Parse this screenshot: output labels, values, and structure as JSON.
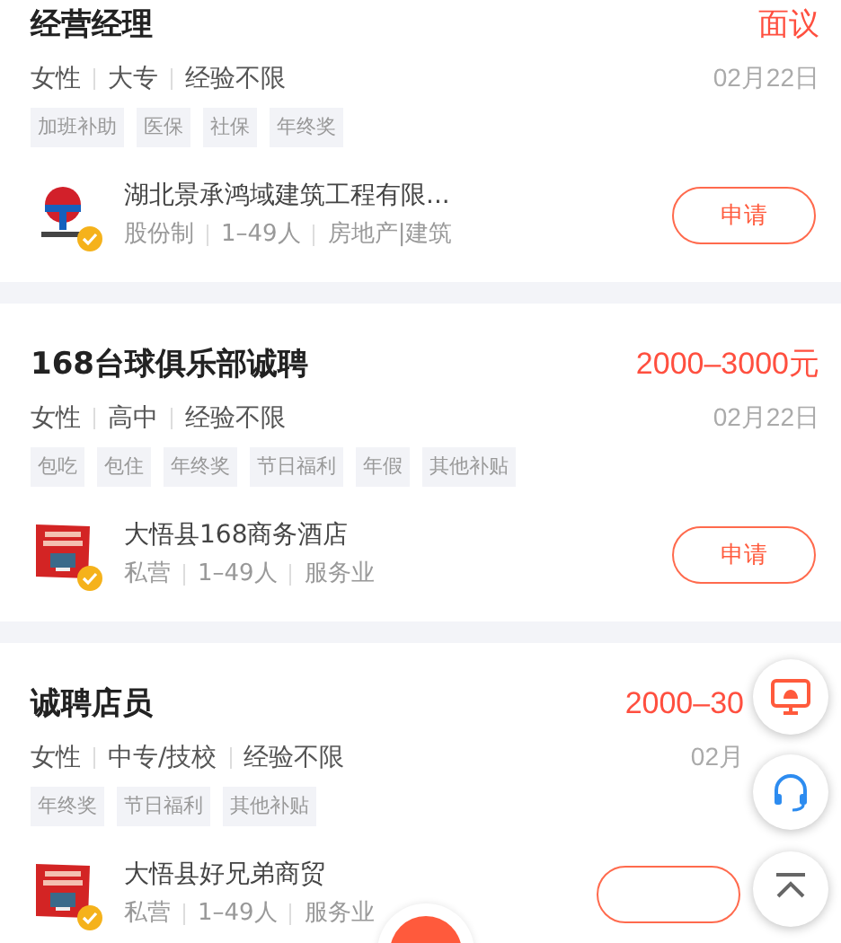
{
  "jobs": [
    {
      "title": "经营经理",
      "salary": "面议",
      "meta": [
        "女性",
        "大专",
        "经验不限"
      ],
      "date": "02月22日",
      "tags": [
        "加班补助",
        "医保",
        "社保",
        "年终奖"
      ],
      "company": {
        "name": "湖北景承鸿域建筑工程有限...",
        "kind": "emblem",
        "verified": true,
        "info": [
          "股份制",
          "1–49人",
          "房地产|建筑"
        ]
      },
      "apply": "申请"
    },
    {
      "title": "168台球俱乐部诚聘",
      "salary": "2000–3000元",
      "meta": [
        "女性",
        "高中",
        "经验不限"
      ],
      "date": "02月22日",
      "tags": [
        "包吃",
        "包住",
        "年终奖",
        "节日福利",
        "年假",
        "其他补贴"
      ],
      "company": {
        "name": "大悟县168商务酒店",
        "kind": "sign",
        "verified": true,
        "info": [
          "私营",
          "1–49人",
          "服务业"
        ]
      },
      "apply": "申请"
    },
    {
      "title": "诚聘店员",
      "salary": "2000–30",
      "meta": [
        "女性",
        "中专/技校",
        "经验不限"
      ],
      "date": "02月",
      "tags": [
        "年终奖",
        "节日福利",
        "其他补贴"
      ],
      "company": {
        "name": "大悟县好兄弟商贸",
        "kind": "sign",
        "verified": true,
        "info": [
          "私营",
          "1–49人",
          "服务业"
        ]
      }
    }
  ]
}
